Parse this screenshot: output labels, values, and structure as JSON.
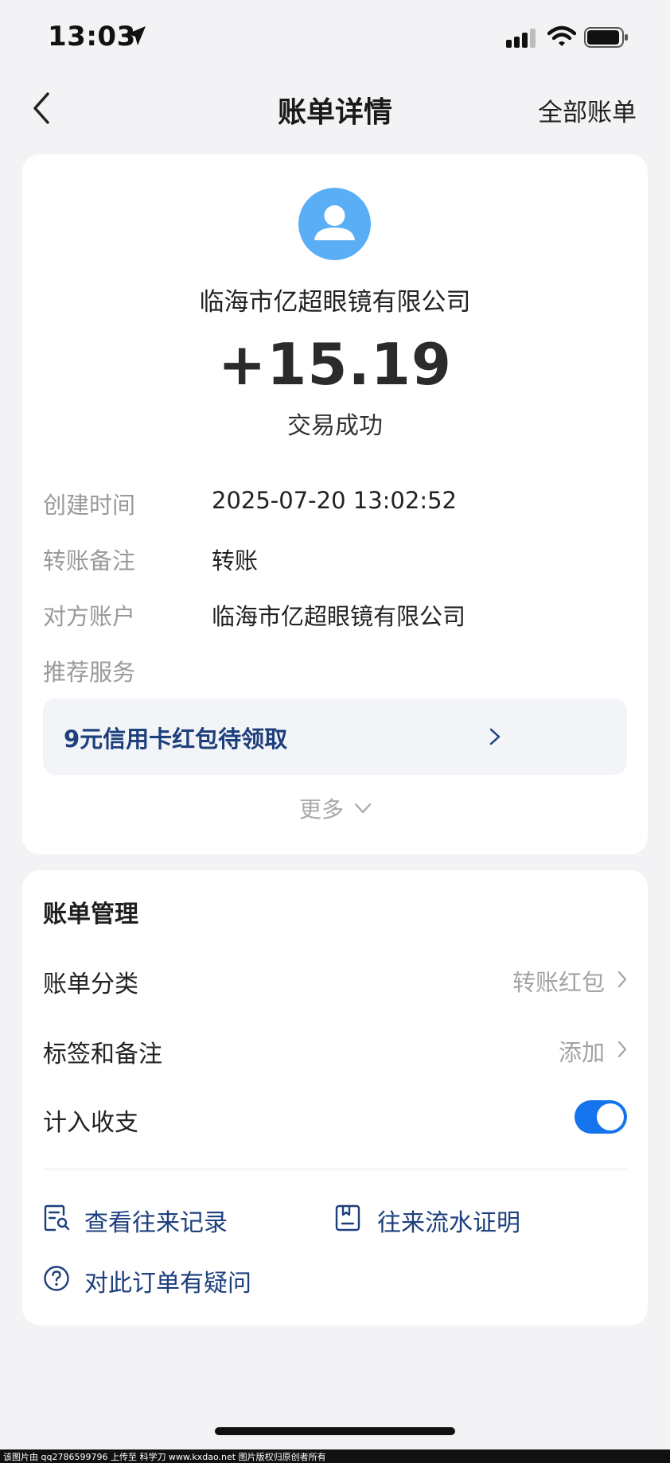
{
  "status_bar": {
    "time": "13:03",
    "icons": [
      "location-arrow-icon",
      "signal-icon",
      "wifi-icon",
      "battery-icon"
    ]
  },
  "nav": {
    "back_icon": "chevron-left-icon",
    "title": "账单详情",
    "right_label": "全部账单"
  },
  "summary": {
    "avatar_icon": "user-avatar-icon",
    "merchant": "临海市亿超眼镜有限公司",
    "amount": "+15.19",
    "status": "交易成功"
  },
  "details": [
    {
      "label": "创建时间",
      "value": "2025-07-20 13:02:52"
    },
    {
      "label": "转账备注",
      "value": "转账"
    },
    {
      "label": "对方账户",
      "value": "临海市亿超眼镜有限公司"
    },
    {
      "label": "推荐服务",
      "value": ""
    }
  ],
  "promo": {
    "text": "9元信用卡红包待领取"
  },
  "more_label": "更多",
  "management": {
    "title": "账单管理",
    "rows": [
      {
        "label": "账单分类",
        "value": "转账红包"
      },
      {
        "label": "标签和备注",
        "value": "添加"
      },
      {
        "label": "计入收支",
        "toggle_on": true
      }
    ]
  },
  "links": [
    {
      "label": "查看往来记录",
      "icon": "record-search-icon"
    },
    {
      "label": "往来流水证明",
      "icon": "certificate-icon"
    },
    {
      "label": "对此订单有疑问",
      "icon": "question-circle-icon"
    }
  ],
  "colors": {
    "accent_blue": "#1673ee",
    "link_blue": "#1d3f7c",
    "avatar_blue": "#5aaef6",
    "background": "#f3f3f5"
  },
  "watermark": "该图片由 qq2786599796 上传至 科学刀 www.kxdao.net 图片版权归原创者所有"
}
